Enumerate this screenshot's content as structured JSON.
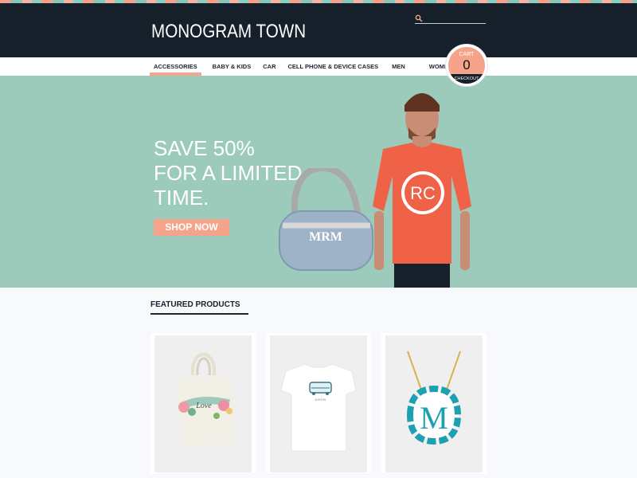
{
  "brand": {
    "name": "MONOGRAM TOWN"
  },
  "search": {
    "value": "",
    "placeholder": ""
  },
  "nav": {
    "items": [
      {
        "label": "ACCESSORIES",
        "active": true
      },
      {
        "label": "BABY & KIDS"
      },
      {
        "label": "CAR"
      },
      {
        "label": "CELL PHONE & DEVICE CASES"
      },
      {
        "label": "MEN"
      },
      {
        "label": "WOMEN"
      }
    ]
  },
  "cart": {
    "label": "CART",
    "count": "0",
    "checkout_label": "CHECKOUT"
  },
  "hero": {
    "title_lines": [
      "SAVE 50%",
      "FOR A LIMITED",
      "TIME."
    ],
    "cta_label": "SHOP NOW",
    "bag_text": "MRM",
    "shirt_text": "RC"
  },
  "featured": {
    "title": "FEATURED PRODUCTS",
    "products": [
      {
        "name": "tote-bag",
        "image_text": "Love"
      },
      {
        "name": "tshirt",
        "image_text": "JUSTIN"
      },
      {
        "name": "monogram-necklace",
        "image_text": "M"
      }
    ]
  },
  "colors": {
    "header_bg": "#16202b",
    "accent": "#f5a48b",
    "hero_bg": "#9ccbbc",
    "page_bg": "#f7f9fc"
  }
}
